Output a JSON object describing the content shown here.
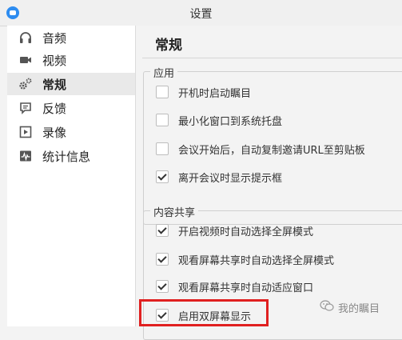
{
  "window": {
    "title": "设置"
  },
  "sidebar": {
    "items": [
      {
        "label": "音频",
        "icon": "headphones-icon"
      },
      {
        "label": "视频",
        "icon": "video-camera-icon"
      },
      {
        "label": "常规",
        "icon": "gears-icon",
        "active": true
      },
      {
        "label": "反馈",
        "icon": "feedback-icon"
      },
      {
        "label": "录像",
        "icon": "recording-icon"
      },
      {
        "label": "统计信息",
        "icon": "statistics-icon"
      }
    ]
  },
  "main": {
    "title": "常规",
    "groups": [
      {
        "title": "应用",
        "options": [
          {
            "label": "开机时启动瞩目",
            "checked": false
          },
          {
            "label": "最小化窗口到系统托盘",
            "checked": false
          },
          {
            "label": "会议开始后，自动复制邀请URL至剪贴板",
            "checked": false
          },
          {
            "label": "离开会议时显示提示框",
            "checked": true
          }
        ]
      },
      {
        "title": "内容共享",
        "options": [
          {
            "label": "开启视频时自动选择全屏模式",
            "checked": true
          },
          {
            "label": "观看屏幕共享时自动选择全屏模式",
            "checked": true
          },
          {
            "label": "观看屏幕共享时自动适应窗口",
            "checked": true
          },
          {
            "label": "启用双屏幕显示",
            "checked": true
          }
        ]
      }
    ]
  },
  "watermark": {
    "text": "我的瞩目",
    "icon": "wechat-icon"
  },
  "colors": {
    "highlight": "#e02020",
    "accent": "#2d8cf0"
  }
}
